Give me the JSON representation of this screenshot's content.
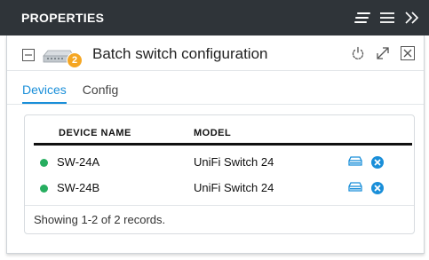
{
  "header": {
    "title": "PROPERTIES"
  },
  "panel": {
    "title": "Batch switch configuration",
    "badge_count": "2"
  },
  "tabs": [
    {
      "label": "Devices",
      "active": true
    },
    {
      "label": "Config",
      "active": false
    }
  ],
  "table": {
    "columns": [
      "DEVICE NAME",
      "MODEL"
    ],
    "rows": [
      {
        "name": "SW-24A",
        "model": "UniFi Switch 24",
        "status_color": "#27ae60"
      },
      {
        "name": "SW-24B",
        "model": "UniFi Switch 24",
        "status_color": "#27ae60"
      }
    ],
    "footer": "Showing 1-2 of 2 records."
  },
  "colors": {
    "accent": "#1a8fd9",
    "badge": "#f5a623",
    "header_bg": "#2f3439",
    "online": "#27ae60"
  },
  "icons": {
    "header": [
      "text-align-icon",
      "menu-icon",
      "double-chevron-right-icon"
    ],
    "title": [
      "collapse-icon",
      "switch-device-icon",
      "power-icon",
      "expand-icon",
      "close-icon"
    ],
    "row_actions": [
      "device-locate-icon",
      "remove-icon"
    ]
  }
}
